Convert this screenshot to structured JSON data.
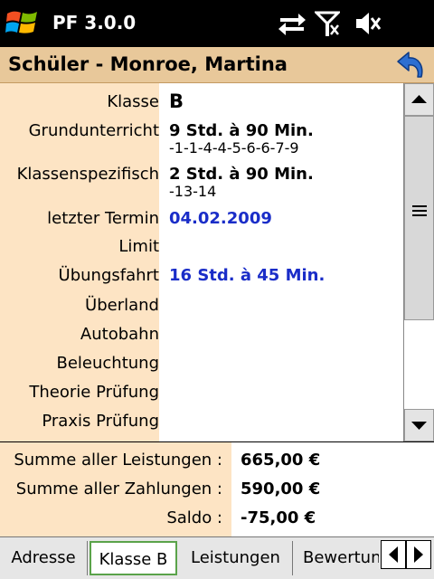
{
  "app": {
    "title": "PF 3.0.0"
  },
  "header": {
    "title": "Schüler - Monroe, Martina"
  },
  "details": {
    "klasse": {
      "label": "Klasse",
      "value": "B"
    },
    "grundunterricht": {
      "label": "Grundunterricht",
      "value": "9 Std. à 90 Min.",
      "detail": "-1-1-4-4-5-6-6-7-9"
    },
    "klassenspezifisch": {
      "label": "Klassenspezifisch",
      "value": "2 Std. à 90 Min.",
      "detail": "-13-14"
    },
    "letzter_termin": {
      "label": "letzter Termin",
      "value": "04.02.2009"
    },
    "limit": {
      "label": "Limit",
      "value": ""
    },
    "uebungsfahrt": {
      "label": "Übungsfahrt",
      "value": "16 Std. à 45 Min."
    },
    "ueberland": {
      "label": "Überland",
      "value": ""
    },
    "autobahn": {
      "label": "Autobahn",
      "value": ""
    },
    "beleuchtung": {
      "label": "Beleuchtung",
      "value": ""
    },
    "theorie_pruefung": {
      "label": "Theorie Prüfung",
      "value": ""
    },
    "praxis_pruefung": {
      "label": "Praxis Prüfung",
      "value": ""
    }
  },
  "summary": {
    "leistungen": {
      "label": "Summe aller Leistungen :",
      "value": "665,00 €"
    },
    "zahlungen": {
      "label": "Summe aller Zahlungen :",
      "value": "590,00 €"
    },
    "saldo": {
      "label": "Saldo :",
      "value": "-75,00 €"
    }
  },
  "tabs": [
    {
      "label": "Adresse",
      "active": false
    },
    {
      "label": "Klasse B",
      "active": true
    },
    {
      "label": "Leistungen",
      "active": false
    },
    {
      "label": "Bewertung",
      "active": false
    }
  ],
  "icons": {
    "start": "windows-logo-icon",
    "connectivity": "sync-arrows-icon",
    "signal": "antenna-signal-icon",
    "volume": "speaker-muted-icon",
    "back": "back-arrow-icon"
  },
  "colors": {
    "header_bg": "#e8c89a",
    "label_bg": "#fde4c4",
    "value_blue": "#1a2dc8",
    "active_tab_border": "#5aa34a"
  }
}
